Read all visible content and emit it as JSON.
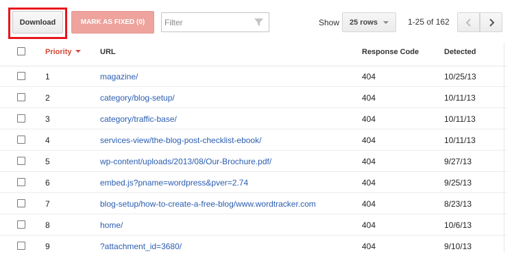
{
  "toolbar": {
    "download_label": "Download",
    "mark_fixed_label": "MARK AS FIXED (0)",
    "filter_placeholder": "Filter",
    "show_label": "Show",
    "rows_per_page": "25 rows",
    "range_text": "1-25 of 162",
    "accent_color": "#d14836",
    "highlight_color": "#e8141c"
  },
  "table": {
    "columns": {
      "priority": "Priority",
      "url": "URL",
      "response_code": "Response Code",
      "detected": "Detected"
    },
    "rows": [
      {
        "priority": "1",
        "url": "magazine/",
        "code": "404",
        "detected": "10/25/13"
      },
      {
        "priority": "2",
        "url": "category/blog-setup/",
        "code": "404",
        "detected": "10/11/13"
      },
      {
        "priority": "3",
        "url": "category/traffic-base/",
        "code": "404",
        "detected": "10/11/13"
      },
      {
        "priority": "4",
        "url": "services-view/the-blog-post-checklist-ebook/",
        "code": "404",
        "detected": "10/11/13"
      },
      {
        "priority": "5",
        "url": "wp-content/uploads/2013/08/Our-Brochure.pdf/",
        "code": "404",
        "detected": "9/27/13"
      },
      {
        "priority": "6",
        "url": "embed.js?pname=wordpress&pver=2.74",
        "code": "404",
        "detected": "9/25/13"
      },
      {
        "priority": "7",
        "url": "blog-setup/how-to-create-a-free-blog/www.wordtracker.com",
        "code": "404",
        "detected": "8/23/13"
      },
      {
        "priority": "8",
        "url": "home/",
        "code": "404",
        "detected": "10/6/13"
      },
      {
        "priority": "9",
        "url": "?attachment_id=3680/",
        "code": "404",
        "detected": "9/10/13"
      }
    ]
  }
}
